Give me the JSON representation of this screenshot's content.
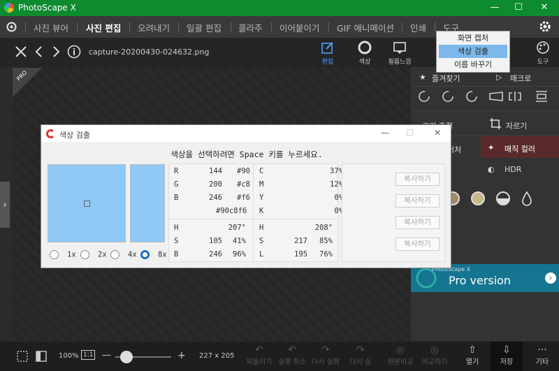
{
  "window": {
    "title": "PhotoScape X",
    "min": "—",
    "max": "☐",
    "close": "✕"
  },
  "nav": {
    "items": [
      "사진 뷰어",
      "사진 편집",
      "오려내기",
      "일괄 편집",
      "콜라주",
      "이어붙이기",
      "GIF 애니메이션",
      "인쇄",
      "도구"
    ],
    "active": "사진 편집"
  },
  "toolbar": {
    "filename": "capture-20200430-024632.png",
    "tools": [
      "편집",
      "색상",
      "필름느낌"
    ],
    "more": "도구",
    "active": "편집"
  },
  "menu": {
    "items": [
      "화면 캡처",
      "색상 검출",
      "이름 바꾸기"
    ],
    "highlight": "색상 검출"
  },
  "right_panel": {
    "favorites": "즐겨찾기",
    "macro": "매크로",
    "crop_adjust": "크기 조절",
    "crop": "자르기",
    "effect": "머처",
    "magic_color": "매직 컬러",
    "hdr": "HDR",
    "pro_small": "PhotoScape X",
    "pro_big": "Pro version"
  },
  "dialog": {
    "title": "색상 검출",
    "instruction": "색상을 선택하려면 Space 키를 누르세요.",
    "color_hex": "#90c8f6",
    "rgb": [
      {
        "k": "R",
        "v": "144",
        "h": "#90"
      },
      {
        "k": "G",
        "v": "200",
        "h": "#c8"
      },
      {
        "k": "B",
        "v": "246",
        "h": "#f6"
      }
    ],
    "hex_line": "#90c8f6",
    "cmyk": [
      {
        "k": "C",
        "v": "37%"
      },
      {
        "k": "M",
        "v": "12%"
      },
      {
        "k": "Y",
        "v": "0%"
      },
      {
        "k": "K",
        "v": "0%"
      }
    ],
    "hsb": [
      {
        "k": "H",
        "a": "",
        "b": "207°"
      },
      {
        "k": "S",
        "a": "105",
        "b": "41%"
      },
      {
        "k": "B",
        "a": "246",
        "b": "96%"
      }
    ],
    "hsl": [
      {
        "k": "H",
        "a": "",
        "b": "208°"
      },
      {
        "k": "S",
        "a": "217",
        "b": "85%"
      },
      {
        "k": "L",
        "a": "195",
        "b": "76%"
      }
    ],
    "copy_label": "복사하기",
    "zoom": [
      "1x",
      "2x",
      "4x",
      "8x"
    ],
    "zoom_selected": "8x"
  },
  "bottom": {
    "zoom": "100%",
    "ratio": "1:1",
    "size": "227 x 205",
    "actions": [
      "되돌리기",
      "실행 취소",
      "다시 실행",
      "다시 실",
      "원본비교",
      "비교하기"
    ],
    "open": "열기",
    "save": "저장",
    "more": "기타"
  }
}
